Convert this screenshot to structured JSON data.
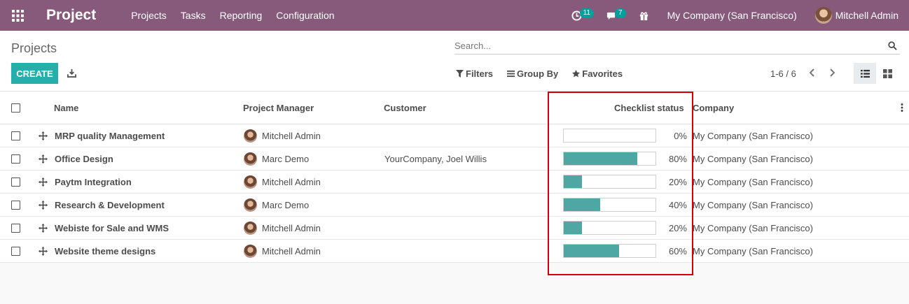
{
  "navbar": {
    "brand": "Project",
    "menu": [
      "Projects",
      "Tasks",
      "Reporting",
      "Configuration"
    ],
    "activity_count": "11",
    "message_count": "7",
    "company": "My Company (San Francisco)",
    "user": "Mitchell Admin",
    "bg_color": "#875a7b"
  },
  "control_panel": {
    "breadcrumb": "Projects",
    "search_placeholder": "Search...",
    "create_label": "CREATE",
    "filters_label": "Filters",
    "groupby_label": "Group By",
    "favorites_label": "Favorites",
    "pager": "1-6 / 6"
  },
  "table": {
    "headers": {
      "name": "Name",
      "manager": "Project Manager",
      "customer": "Customer",
      "checklist": "Checklist status",
      "company": "Company"
    },
    "rows": [
      {
        "name": "MRP quality Management",
        "manager": "Mitchell Admin",
        "customer": "",
        "progress": 0,
        "progress_label": "0%",
        "company": "My Company (San Francisco)"
      },
      {
        "name": "Office Design",
        "manager": "Marc Demo",
        "customer": "YourCompany, Joel Willis",
        "progress": 80,
        "progress_label": "80%",
        "company": "My Company (San Francisco)"
      },
      {
        "name": "Paytm Integration",
        "manager": "Mitchell Admin",
        "customer": "",
        "progress": 20,
        "progress_label": "20%",
        "company": "My Company (San Francisco)"
      },
      {
        "name": "Research & Development",
        "manager": "Marc Demo",
        "customer": "",
        "progress": 40,
        "progress_label": "40%",
        "company": "My Company (San Francisco)"
      },
      {
        "name": "Webiste for Sale and WMS",
        "manager": "Mitchell Admin",
        "customer": "",
        "progress": 20,
        "progress_label": "20%",
        "company": "My Company (San Francisco)"
      },
      {
        "name": "Website theme designs",
        "manager": "Mitchell Admin",
        "customer": "",
        "progress": 60,
        "progress_label": "60%",
        "company": "My Company (San Francisco)"
      }
    ]
  },
  "colors": {
    "accent": "#00a09d",
    "progress": "#4ea7a3",
    "highlight": "#d40000"
  }
}
